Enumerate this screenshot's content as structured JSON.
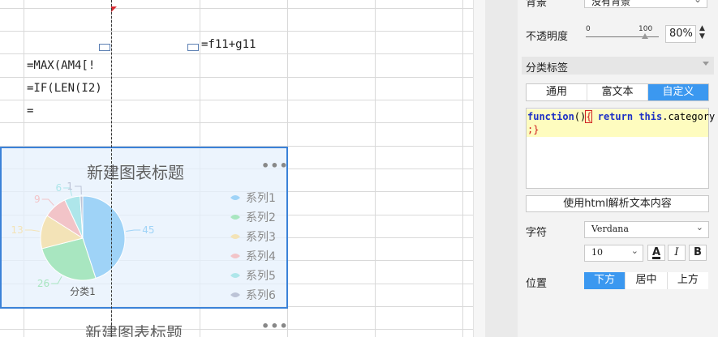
{
  "sheet": {
    "formulas": [
      "=f11+g11",
      "=MAX(AM4[!",
      "=IF(LEN(I2)",
      "="
    ]
  },
  "chart": {
    "title": "新建图表标题",
    "more": "•••",
    "category_label": "分类1",
    "chart_data": {
      "type": "pie",
      "title": "新建图表标题",
      "categories": [
        "系列1",
        "系列2",
        "系列3",
        "系列4",
        "系列5",
        "系列6"
      ],
      "values": [
        45,
        26,
        13,
        9,
        6,
        1
      ],
      "category": "分类1",
      "legend": "right",
      "colors": [
        "#9fd3f7",
        "#a8e6c0",
        "#f3e3b7",
        "#f2c4c8",
        "#aee6ea",
        "#bcc3d6"
      ]
    }
  },
  "chart2": {
    "title": "新建图表标题",
    "more": "•••"
  },
  "panel": {
    "top_row": {
      "label": "背景",
      "value": "没有背景"
    },
    "opacity": {
      "label": "不透明度",
      "scale_min": "0",
      "scale_max": "100",
      "value": "80%",
      "level": 0.8
    },
    "section_title": "分类标签",
    "tabs": [
      {
        "label": "通用",
        "active": false
      },
      {
        "label": "富文本",
        "active": false
      },
      {
        "label": "自定义",
        "active": true
      }
    ],
    "code": {
      "kw1": "function",
      "paren": "()",
      "brace_open": "{",
      "kw2": "return",
      "kw3": "this",
      "rest": ".category",
      "line2": ";}"
    },
    "html_button": "使用html解析文本内容",
    "font": {
      "label": "字符",
      "family": "Verdana",
      "size": "10",
      "color_btn": "A",
      "italic_btn": "I",
      "bold_btn": "B"
    },
    "position": {
      "label": "位置",
      "options": [
        {
          "label": "下方",
          "active": true
        },
        {
          "label": "居中",
          "active": false
        },
        {
          "label": "上方",
          "active": false
        }
      ]
    }
  }
}
